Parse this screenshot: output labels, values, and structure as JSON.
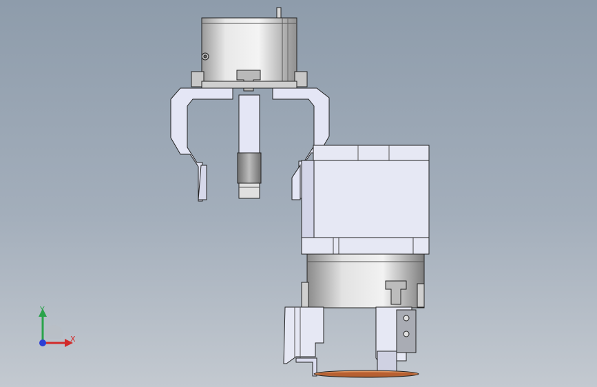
{
  "viewport": {
    "background_top": "#8e9cab",
    "background_bottom": "#c3c9d0"
  },
  "model": {
    "body_color": "#e6e8f4",
    "cylinder_color": "#d8d8d8",
    "edge_color": "#222222",
    "ring_color": "#c86f3d"
  },
  "triad": {
    "x_label": "X",
    "y_label": "Y",
    "x_color": "#d22a2a",
    "y_color": "#2aa34a",
    "z_color": "#2b3fd6"
  }
}
